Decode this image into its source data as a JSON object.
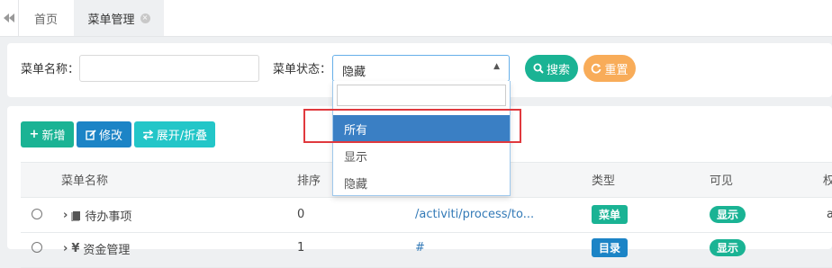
{
  "tabs": {
    "home": "首页",
    "active": "菜单管理",
    "close": "×"
  },
  "search": {
    "name_label": "菜单名称：",
    "name_value": "",
    "status_label": "菜单状态：",
    "status_value": "隐藏",
    "search_button": "搜索",
    "reset_button": "重置"
  },
  "dropdown": {
    "search_value": "",
    "options": [
      "所有",
      "显示",
      "隐藏"
    ],
    "selected": "所有"
  },
  "toolbar": {
    "add": "新增",
    "edit": "修改",
    "toggle": "展开/折叠"
  },
  "table": {
    "headers": [
      "菜单名称",
      "排序",
      "类型",
      "可见",
      "权"
    ],
    "rows": [
      {
        "name": "待办事项",
        "order": "0",
        "url": "/activiti/process/to...",
        "type": "菜单",
        "visible": "显示",
        "perm": "a"
      },
      {
        "name": "资金管理",
        "order": "1",
        "url": "#",
        "type": "目录",
        "visible": "显示",
        "perm": ""
      }
    ]
  },
  "colors": {
    "primary": "#1ab394",
    "info": "#1c84c6",
    "warning": "#f8ac59",
    "cyan": "#23c6c8",
    "highlight": "#e0393e",
    "selected": "#3a7fc4"
  }
}
